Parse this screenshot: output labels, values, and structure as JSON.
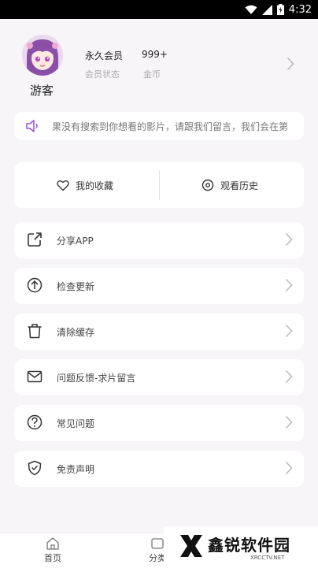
{
  "status_bar": {
    "time": "4:32"
  },
  "profile": {
    "nickname": "游客",
    "membership": {
      "value": "永久会员",
      "label": "会员状态"
    },
    "coins": {
      "value": "999+",
      "label": "金币"
    }
  },
  "notice": {
    "text": "果没有搜索到你想看的影片，请跟我们留言，我们会在第"
  },
  "quick_actions": [
    {
      "label": "我的收藏",
      "icon": "heart-icon"
    },
    {
      "label": "观看历史",
      "icon": "history-icon"
    }
  ],
  "menu": [
    {
      "label": "分享APP",
      "icon": "share-icon"
    },
    {
      "label": "检查更新",
      "icon": "upload-icon"
    },
    {
      "label": "清除缓存",
      "icon": "trash-icon"
    },
    {
      "label": "问题反馈-求片留言",
      "icon": "mail-icon"
    },
    {
      "label": "常见问题",
      "icon": "question-icon"
    },
    {
      "label": "免责声明",
      "icon": "shield-check-icon"
    }
  ],
  "tabbar": [
    {
      "label": "首页",
      "icon": "home-icon"
    },
    {
      "label": "分类",
      "icon": "category-icon"
    }
  ],
  "watermark": {
    "text": "鑫锐软件园",
    "sub": "XRCCTV.NET"
  }
}
